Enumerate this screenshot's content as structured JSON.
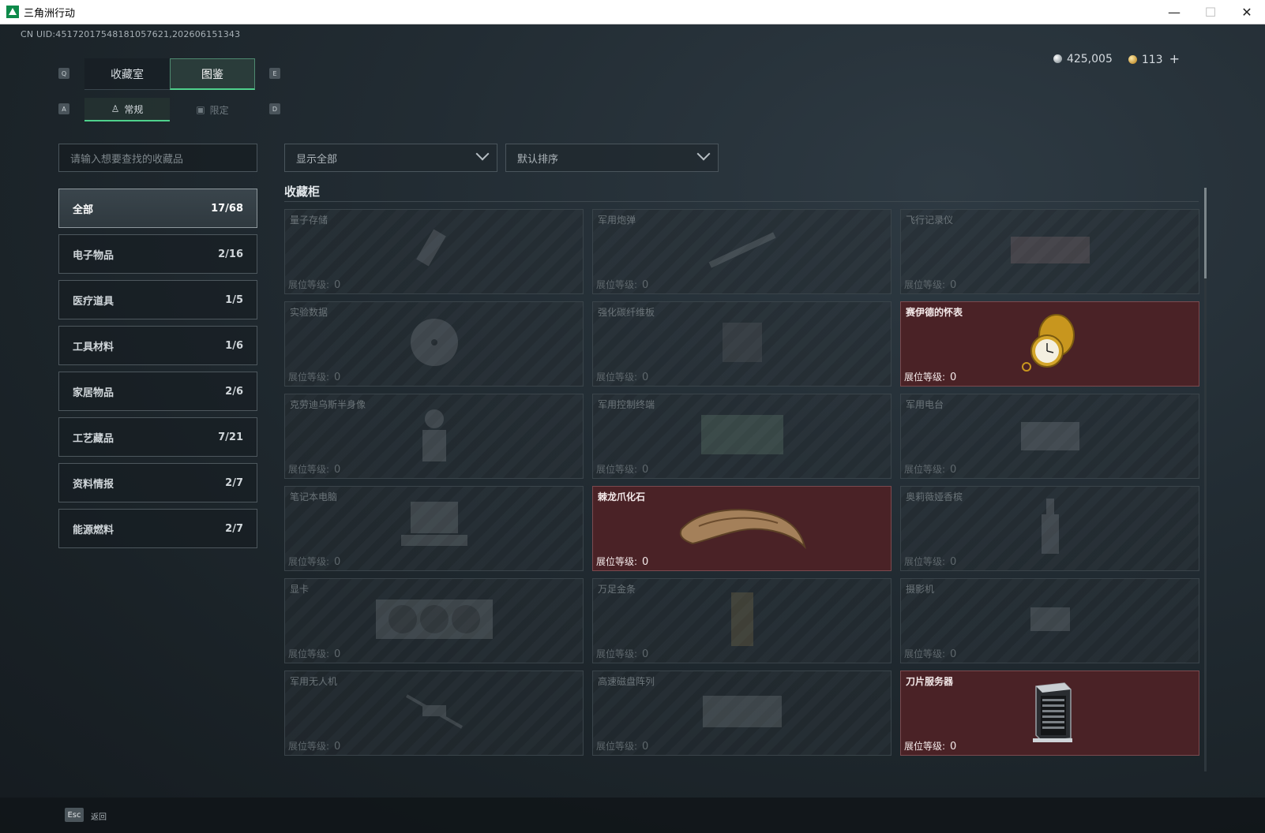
{
  "window": {
    "title": "三角洲行动",
    "minimize": "—",
    "maximize": "☐",
    "close": "✕"
  },
  "uid": "CN UID:45172017548181057621,202606151343",
  "currency": {
    "silver": "425,005",
    "gold": "113",
    "add": "+"
  },
  "keys": {
    "q": "Q",
    "e": "E",
    "a": "A",
    "d": "D"
  },
  "main_tabs": [
    {
      "label": "收藏室",
      "active": false
    },
    {
      "label": "图鉴",
      "active": true
    }
  ],
  "sub_tabs": [
    {
      "label": "常规",
      "icon": "figure-icon",
      "active": true
    },
    {
      "label": "限定",
      "icon": "picture-icon",
      "active": false
    }
  ],
  "search": {
    "placeholder": "请输入想要查找的收藏品"
  },
  "filters": {
    "show": "显示全部",
    "sort": "默认排序"
  },
  "categories": [
    {
      "label": "全部",
      "count": "17/68",
      "active": true
    },
    {
      "label": "电子物品",
      "count": "2/16"
    },
    {
      "label": "医疗道具",
      "count": "1/5"
    },
    {
      "label": "工具材料",
      "count": "1/6"
    },
    {
      "label": "家居物品",
      "count": "2/6"
    },
    {
      "label": "工艺藏品",
      "count": "7/21"
    },
    {
      "label": "资料情报",
      "count": "2/7"
    },
    {
      "label": "能源燃料",
      "count": "2/7"
    }
  ],
  "section_title": "收藏柜",
  "level_label": "展位等级:",
  "items": [
    {
      "name": "量子存储",
      "level": "0",
      "owned": false,
      "icon": "usb-drive-icon"
    },
    {
      "name": "军用炮弹",
      "level": "0",
      "owned": false,
      "icon": "shell-icon"
    },
    {
      "name": "飞行记录仪",
      "level": "0",
      "owned": false,
      "icon": "flight-recorder-icon"
    },
    {
      "name": "实验数据",
      "level": "0",
      "owned": false,
      "icon": "disc-icon"
    },
    {
      "name": "强化碳纤维板",
      "level": "0",
      "owned": false,
      "icon": "carbon-plate-icon"
    },
    {
      "name": "赛伊德的怀表",
      "level": "0",
      "owned": true,
      "icon": "pocket-watch-icon"
    },
    {
      "name": "克劳迪乌斯半身像",
      "level": "0",
      "owned": false,
      "icon": "bust-icon"
    },
    {
      "name": "军用控制终端",
      "level": "0",
      "owned": false,
      "icon": "terminal-icon"
    },
    {
      "name": "军用电台",
      "level": "0",
      "owned": false,
      "icon": "radio-icon"
    },
    {
      "name": "笔记本电脑",
      "level": "0",
      "owned": false,
      "icon": "laptop-icon"
    },
    {
      "name": "棘龙爪化石",
      "level": "0",
      "owned": true,
      "icon": "claw-fossil-icon"
    },
    {
      "name": "奥莉薇娅香槟",
      "level": "0",
      "owned": false,
      "icon": "champagne-icon"
    },
    {
      "name": "显卡",
      "level": "0",
      "owned": false,
      "icon": "gpu-icon"
    },
    {
      "name": "万足金条",
      "level": "0",
      "owned": false,
      "icon": "gold-bar-icon"
    },
    {
      "name": "摄影机",
      "level": "0",
      "owned": false,
      "icon": "camera-icon"
    },
    {
      "name": "军用无人机",
      "level": "0",
      "owned": false,
      "icon": "drone-icon"
    },
    {
      "name": "高速磁盘阵列",
      "level": "0",
      "owned": false,
      "icon": "disk-array-icon"
    },
    {
      "name": "刀片服务器",
      "level": "0",
      "owned": true,
      "icon": "blade-server-icon"
    }
  ],
  "footer": {
    "esc_key": "Esc",
    "back_label": "返回"
  }
}
